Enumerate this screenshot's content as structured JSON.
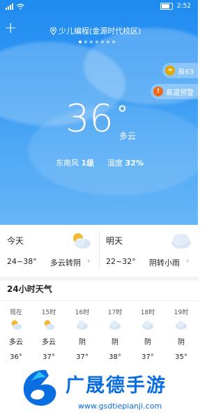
{
  "status": {
    "time": "2:52"
  },
  "header": {
    "add_label": "+",
    "location": "少儿编程(金源时代校区)",
    "page_count": 7,
    "active_page": 0
  },
  "badges": {
    "aqi": "良63",
    "alert": "高温预警"
  },
  "current": {
    "temperature": "36",
    "degree": "°",
    "condition": "多云",
    "wind_label": "东南风",
    "wind_value": "1级",
    "humidity_label": "湿度",
    "humidity_value": "32%"
  },
  "forecast": [
    {
      "day": "今天",
      "range": "24~38°",
      "desc": "多云转阴",
      "chevron": "›"
    },
    {
      "day": "明天",
      "range": "22~32°",
      "desc": "阴转小雨",
      "chevron": "›"
    }
  ],
  "hourly": {
    "title": "24小时天气",
    "items": [
      {
        "time": "现在",
        "weather": "多云",
        "temp": "36°",
        "icon": "partly-cloudy-icon"
      },
      {
        "time": "15时",
        "weather": "多云",
        "temp": "37°",
        "icon": "partly-cloudy-icon"
      },
      {
        "time": "16时",
        "weather": "阴",
        "temp": "37°",
        "icon": "cloudy-icon"
      },
      {
        "time": "17时",
        "weather": "阴",
        "temp": "38°",
        "icon": "cloudy-icon"
      },
      {
        "time": "18时",
        "weather": "阴",
        "temp": "37°",
        "icon": "cloudy-icon"
      },
      {
        "time": "19时",
        "weather": "阴",
        "temp": "35°",
        "icon": "cloudy-icon"
      }
    ]
  },
  "watermark": {
    "name": "广晟德手游",
    "url": "www.gsdtiepianji.com"
  },
  "colors": {
    "sky_top": "#1f8bf0",
    "sky_bottom": "#67b6f7",
    "aqi_icon": "#e0a800",
    "alert_icon": "#f06a1a",
    "watermark": "#0a6de0"
  }
}
